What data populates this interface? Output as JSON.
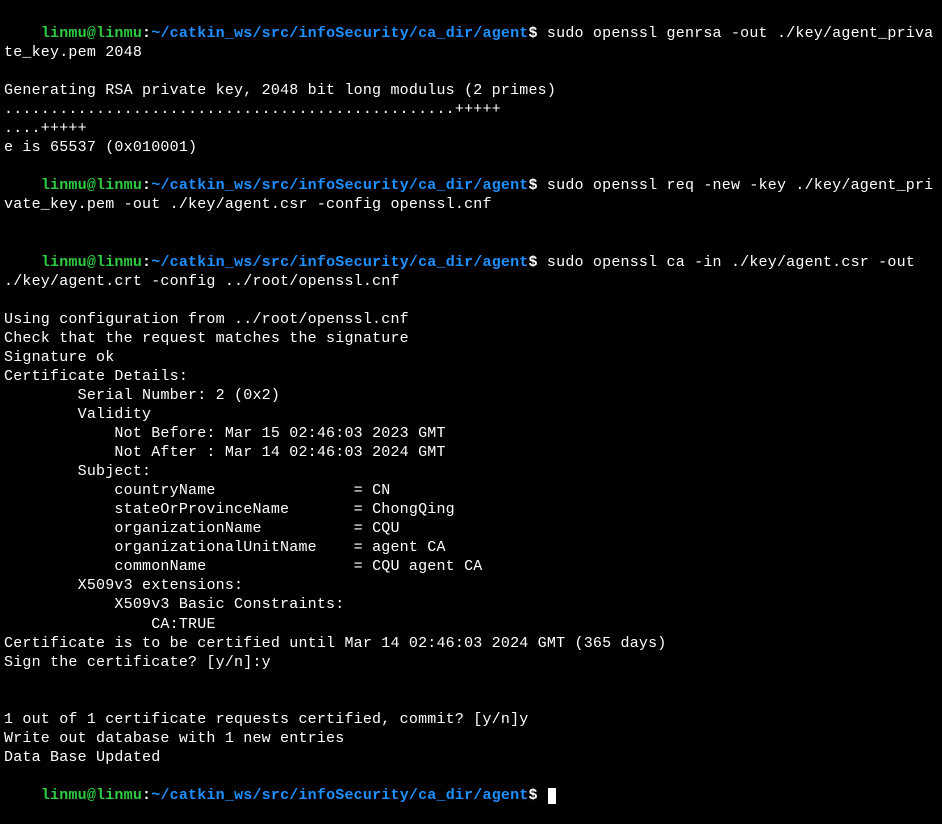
{
  "prompt": {
    "user": "linmu",
    "at": "@",
    "host": "linmu",
    "colon": ":",
    "path": "~/catkin_ws/src/infoSecurity/ca_dir/agent",
    "dollar": "$"
  },
  "cmds": {
    "genrsa": "sudo openssl genrsa -out ./key/agent_private_key.pem 2048",
    "req": "sudo openssl req -new -key ./key/agent_private_key.pem -out ./key/agent.csr -config openssl.cnf",
    "ca": "sudo openssl ca -in ./key/agent.csr -out ./key/agent.crt -config ../root/openssl.cnf",
    "idle": ""
  },
  "genrsa_out": {
    "l1": "Generating RSA private key, 2048 bit long modulus (2 primes)",
    "l2": ".................................................+++++",
    "l3": "....+++++",
    "l4": "e is 65537 (0x010001)"
  },
  "ca_out": {
    "l01": "Using configuration from ../root/openssl.cnf",
    "l02": "Check that the request matches the signature",
    "l03": "Signature ok",
    "l04": "Certificate Details:",
    "l05": "        Serial Number: 2 (0x2)",
    "l06": "        Validity",
    "l07": "            Not Before: Mar 15 02:46:03 2023 GMT",
    "l08": "            Not After : Mar 14 02:46:03 2024 GMT",
    "l09": "        Subject:",
    "l10": "            countryName               = CN",
    "l11": "            stateOrProvinceName       = ChongQing",
    "l12": "            organizationName          = CQU",
    "l13": "            organizationalUnitName    = agent CA",
    "l14": "            commonName                = CQU agent CA",
    "l15": "        X509v3 extensions:",
    "l16": "            X509v3 Basic Constraints: ",
    "l17": "                CA:TRUE",
    "l18": "Certificate is to be certified until Mar 14 02:46:03 2024 GMT (365 days)",
    "l19": "Sign the certificate? [y/n]:y",
    "l20": "1 out of 1 certificate requests certified, commit? [y/n]y",
    "l21": "Write out database with 1 new entries",
    "l22": "Data Base Updated"
  }
}
